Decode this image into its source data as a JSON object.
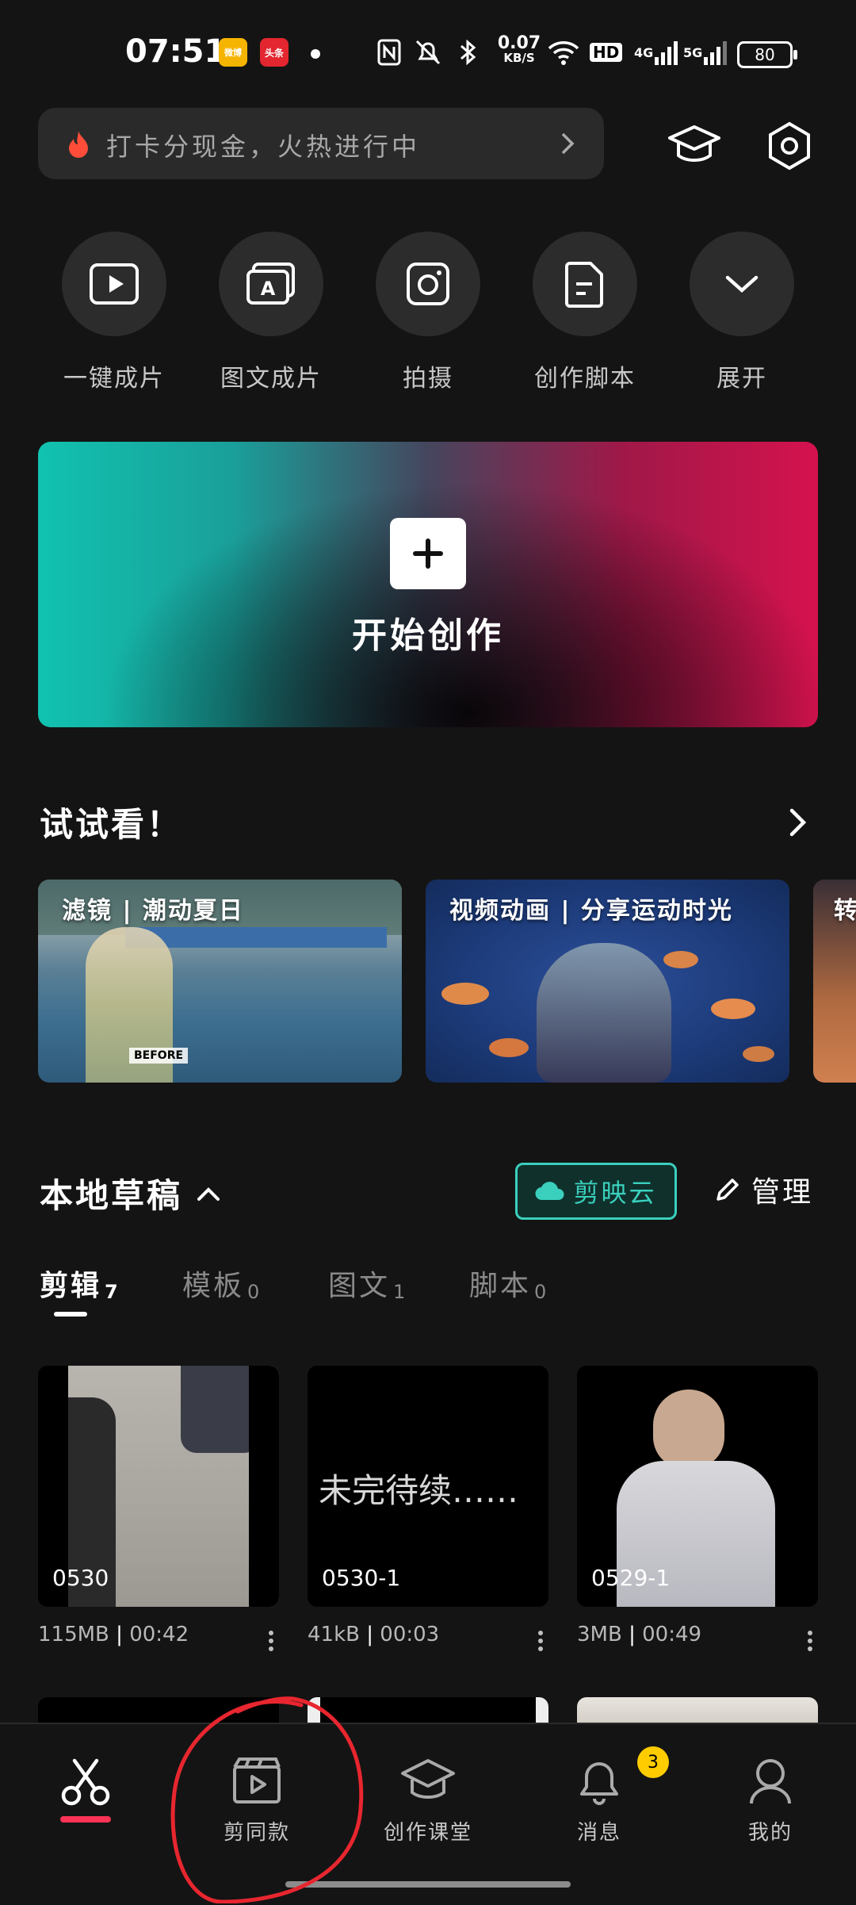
{
  "status_bar": {
    "time": "07:51",
    "app_badges": [
      "微博",
      "头条"
    ],
    "net_speed_value": "0.07",
    "net_speed_unit": "KB/S",
    "hd": "HD",
    "signal1": "4G",
    "signal2": "5G",
    "battery": "80"
  },
  "search": {
    "text": "打卡分现金，火热进行中"
  },
  "quick_actions": [
    {
      "label": "一键成片",
      "icon": "play-frame-icon"
    },
    {
      "label": "图文成片",
      "icon": "text-image-icon"
    },
    {
      "label": "拍摄",
      "icon": "camera-icon"
    },
    {
      "label": "创作脚本",
      "icon": "script-doc-icon"
    },
    {
      "label": "展开",
      "icon": "chevron-down-icon"
    }
  ],
  "banner": {
    "title": "开始创作"
  },
  "try_section": {
    "title": "试试看！",
    "items": [
      {
        "caption": "滤镜 | 潮动夏日",
        "watermark": "BEFORE"
      },
      {
        "caption": "视频动画 | 分享运动时光"
      },
      {
        "caption": "转"
      }
    ]
  },
  "local_drafts": {
    "title": "本地草稿",
    "cloud_button": "剪映云",
    "manage": "管理",
    "tabs": [
      {
        "label": "剪辑",
        "count": "7",
        "active": true
      },
      {
        "label": "模板",
        "count": "0"
      },
      {
        "label": "图文",
        "count": "1"
      },
      {
        "label": "脚本",
        "count": "0"
      }
    ],
    "drafts": [
      {
        "name": "0530",
        "size": "115MB",
        "duration": "00:42"
      },
      {
        "name": "0530-1",
        "size": "41kB",
        "duration": "00:03",
        "overlay_text": "未完待续……"
      },
      {
        "name": "0529-1",
        "size": "3MB",
        "duration": "00:49"
      }
    ]
  },
  "bottom_nav": {
    "items": [
      {
        "label": "",
        "icon": "scissors-icon",
        "active": true
      },
      {
        "label": "剪同款",
        "icon": "clapper-play-icon"
      },
      {
        "label": "创作课堂",
        "icon": "graduation-cap-icon"
      },
      {
        "label": "消息",
        "icon": "bell-icon",
        "badge": "3"
      },
      {
        "label": "我的",
        "icon": "person-icon"
      }
    ]
  },
  "colors": {
    "accent": "#3ad0bd",
    "active_underline": "#ff3355",
    "badge": "#ffcc00"
  }
}
